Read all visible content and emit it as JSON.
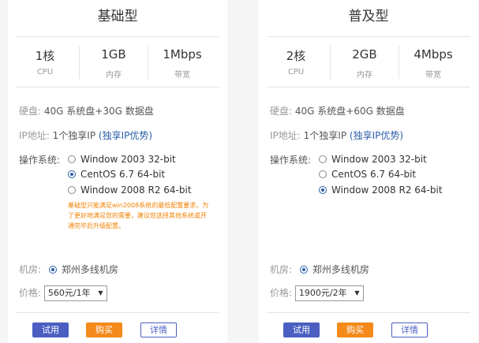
{
  "cards": [
    {
      "title": "基础型",
      "specs": [
        {
          "value": "1核",
          "label": "CPU"
        },
        {
          "value": "1GB",
          "label": "内存"
        },
        {
          "value": "1Mbps",
          "label": "带宽"
        }
      ],
      "disk_label": "硬盘:",
      "disk_value": "40G 系统盘+30G 数据盘",
      "ip_label": "IP地址:",
      "ip_value": "1个独享IP",
      "ip_link": "(独享IP优势)",
      "os_label": "操作系统:",
      "os_options": [
        {
          "label": "Window 2003 32-bit",
          "selected": false
        },
        {
          "label": "CentOS 6.7 64-bit",
          "selected": true
        },
        {
          "label": "Window 2008 R2 64-bit",
          "selected": false
        }
      ],
      "note": "基础型只能满足win2008系统的最低配置要求，为了更好地满足您的需要，建议您选择其他系统或开通完毕后升级配置。",
      "room_label": "机房:",
      "room_value": "郑州多线机房",
      "price_label": "价格:",
      "price_value": "560元/1年",
      "btn_try": "试用",
      "btn_buy": "购买",
      "btn_detail": "详情"
    },
    {
      "title": "普及型",
      "specs": [
        {
          "value": "2核",
          "label": "CPU"
        },
        {
          "value": "2GB",
          "label": "内存"
        },
        {
          "value": "4Mbps",
          "label": "带宽"
        }
      ],
      "disk_label": "硬盘:",
      "disk_value": "40G 系统盘+60G 数据盘",
      "ip_label": "IP地址:",
      "ip_value": "1个独享IP",
      "ip_link": "(独享IP优势)",
      "os_label": "操作系统:",
      "os_options": [
        {
          "label": "Window 2003 32-bit",
          "selected": false
        },
        {
          "label": "CentOS 6.7 64-bit",
          "selected": false
        },
        {
          "label": "Window 2008 R2 64-bit",
          "selected": true
        }
      ],
      "note": "",
      "room_label": "机房:",
      "room_value": "郑州多线机房",
      "price_label": "价格:",
      "price_value": "1900元/2年",
      "btn_try": "试用",
      "btn_buy": "购买",
      "btn_detail": "详情"
    }
  ],
  "colors": {
    "accent": "#4a5fc1",
    "buy": "#f48a1a",
    "link": "#2a5ea8",
    "note": "#f08000"
  }
}
